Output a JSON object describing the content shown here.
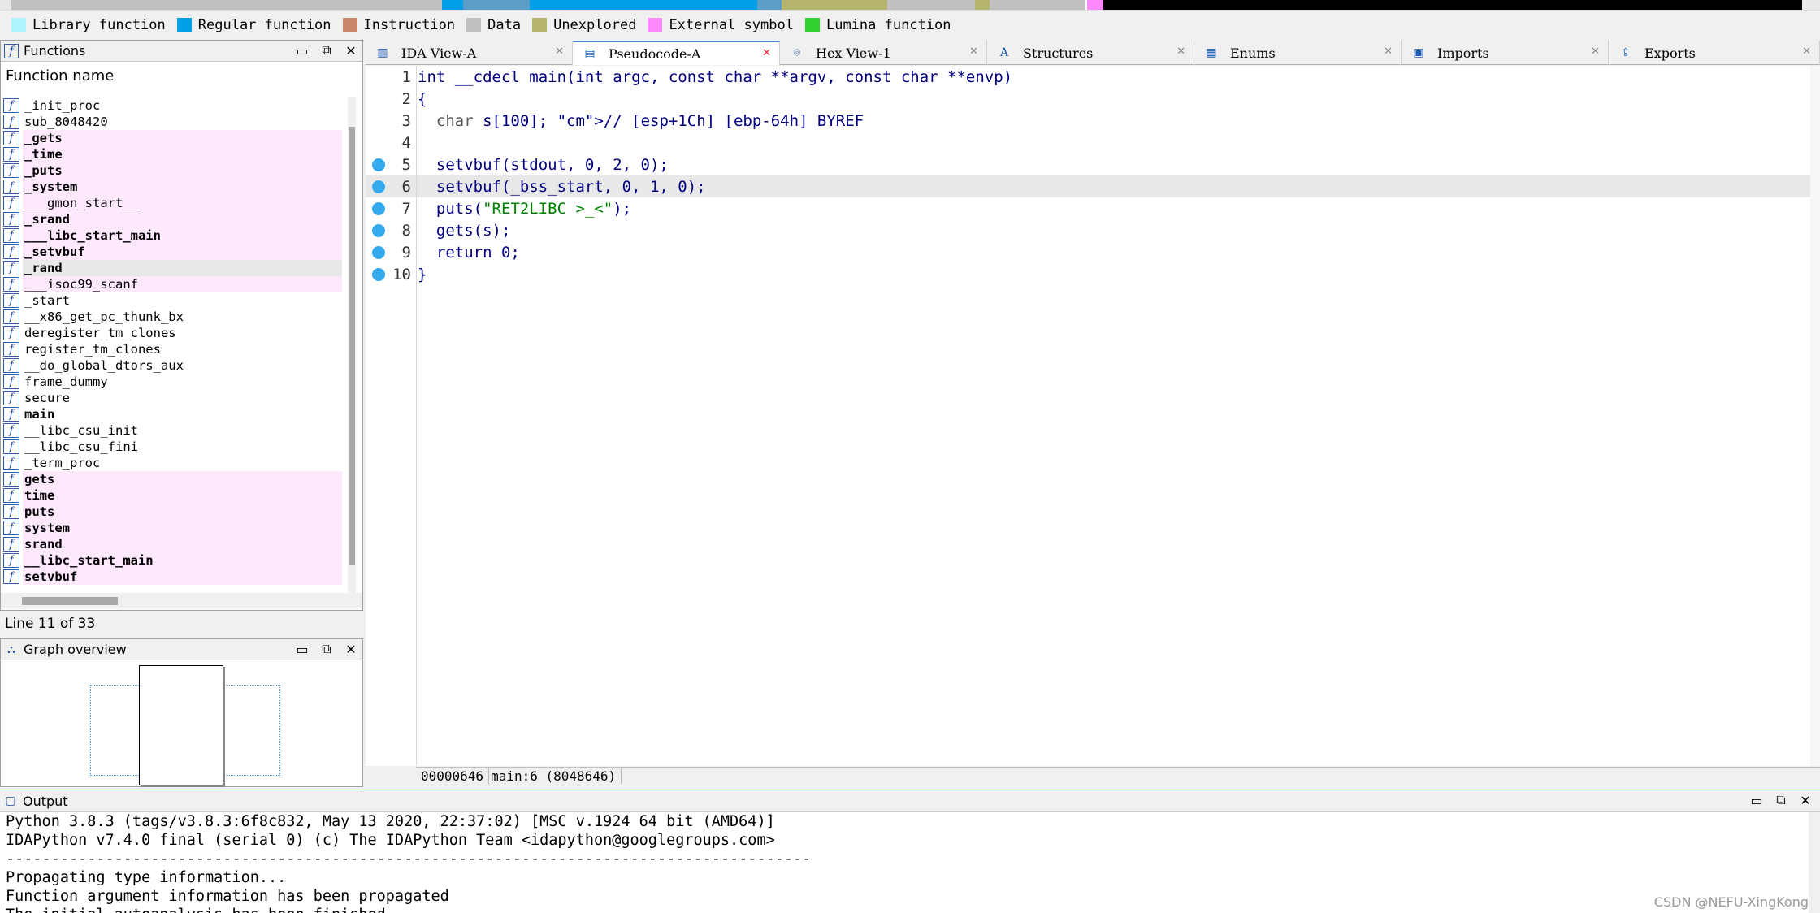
{
  "legend": [
    {
      "label": "Library function",
      "color": "#aef2fe"
    },
    {
      "label": "Regular function",
      "color": "#00a0e8"
    },
    {
      "label": "Instruction",
      "color": "#c8876a"
    },
    {
      "label": "Data",
      "color": "#c0c0c0"
    },
    {
      "label": "Unexplored",
      "color": "#b4b46c"
    },
    {
      "label": "External symbol",
      "color": "#ff88ff"
    },
    {
      "label": "Lumina function",
      "color": "#30d030"
    }
  ],
  "functions_panel": {
    "title": "Functions",
    "header": "Function name",
    "items": [
      {
        "name": "_init_proc",
        "style": "lib"
      },
      {
        "name": "sub_8048420",
        "style": "lib"
      },
      {
        "name": "_gets",
        "style": "ext bold"
      },
      {
        "name": "_time",
        "style": "ext bold"
      },
      {
        "name": "_puts",
        "style": "ext bold"
      },
      {
        "name": "_system",
        "style": "ext bold"
      },
      {
        "name": "___gmon_start__",
        "style": "ext"
      },
      {
        "name": "_srand",
        "style": "ext bold"
      },
      {
        "name": "___libc_start_main",
        "style": "ext bold"
      },
      {
        "name": "_setvbuf",
        "style": "ext bold"
      },
      {
        "name": "_rand",
        "style": "sel bold"
      },
      {
        "name": "___isoc99_scanf",
        "style": "ext"
      },
      {
        "name": "_start",
        "style": "lib"
      },
      {
        "name": "__x86_get_pc_thunk_bx",
        "style": "lib"
      },
      {
        "name": "deregister_tm_clones",
        "style": "lib"
      },
      {
        "name": "register_tm_clones",
        "style": "lib"
      },
      {
        "name": "__do_global_dtors_aux",
        "style": "lib"
      },
      {
        "name": "frame_dummy",
        "style": "lib"
      },
      {
        "name": "secure",
        "style": "lib"
      },
      {
        "name": "main",
        "style": "lib bold"
      },
      {
        "name": "__libc_csu_init",
        "style": "lib"
      },
      {
        "name": "__libc_csu_fini",
        "style": "lib"
      },
      {
        "name": "_term_proc",
        "style": "lib"
      },
      {
        "name": "gets",
        "style": "ext bold"
      },
      {
        "name": "time",
        "style": "ext bold"
      },
      {
        "name": "puts",
        "style": "ext bold"
      },
      {
        "name": "system",
        "style": "ext bold"
      },
      {
        "name": "srand",
        "style": "ext bold"
      },
      {
        "name": "__libc_start_main",
        "style": "ext bold"
      },
      {
        "name": "setvbuf",
        "style": "ext bold"
      }
    ],
    "line_status": "Line 11 of 33"
  },
  "graph_panel": {
    "title": "Graph overview"
  },
  "tabs": [
    {
      "label": "IDA View-A",
      "icon": "ida-view-icon",
      "active": false
    },
    {
      "label": "Pseudocode-A",
      "icon": "pseudocode-icon",
      "active": true
    },
    {
      "label": "Hex View-1",
      "icon": "hex-view-icon",
      "active": false
    },
    {
      "label": "Structures",
      "icon": "structures-icon",
      "active": false
    },
    {
      "label": "Enums",
      "icon": "enums-icon",
      "active": false
    },
    {
      "label": "Imports",
      "icon": "imports-icon",
      "active": false
    },
    {
      "label": "Exports",
      "icon": "exports-icon",
      "active": false
    }
  ],
  "code": {
    "lines": [
      {
        "n": "1",
        "bp": false,
        "text": "int __cdecl main(int argc, const char **argv, const char **envp)"
      },
      {
        "n": "2",
        "bp": false,
        "text": "{"
      },
      {
        "n": "3",
        "bp": false,
        "text": "  char s[100]; // [esp+1Ch] [ebp-64h] BYREF"
      },
      {
        "n": "4",
        "bp": false,
        "text": ""
      },
      {
        "n": "5",
        "bp": true,
        "text": "  setvbuf(stdout, 0, 2, 0);"
      },
      {
        "n": "6",
        "bp": true,
        "text": "  setvbuf(_bss_start, 0, 1, 0);"
      },
      {
        "n": "7",
        "bp": true,
        "text": "  puts(\"RET2LIBC >_<\");"
      },
      {
        "n": "8",
        "bp": true,
        "text": "  gets(s);"
      },
      {
        "n": "9",
        "bp": true,
        "text": "  return 0;"
      },
      {
        "n": "10",
        "bp": true,
        "text": "}"
      }
    ],
    "highlighted_line": "6",
    "status": [
      "00000646",
      "main:6 (8048646)"
    ]
  },
  "output": {
    "title": "Output",
    "lines": [
      "Python 3.8.3 (tags/v3.8.3:6f8c832, May 13 2020, 22:37:02) [MSC v.1924 64 bit (AMD64)]",
      "IDAPython v7.4.0 final (serial 0) (c) The IDAPython Team <idapython@googlegroups.com>",
      "-----------------------------------------------------------------------------------------",
      "Propagating type information...",
      "Function argument information has been propagated",
      "The initial autoanalysis has been finished."
    ]
  },
  "watermark": "CSDN @NEFU-XingKong"
}
